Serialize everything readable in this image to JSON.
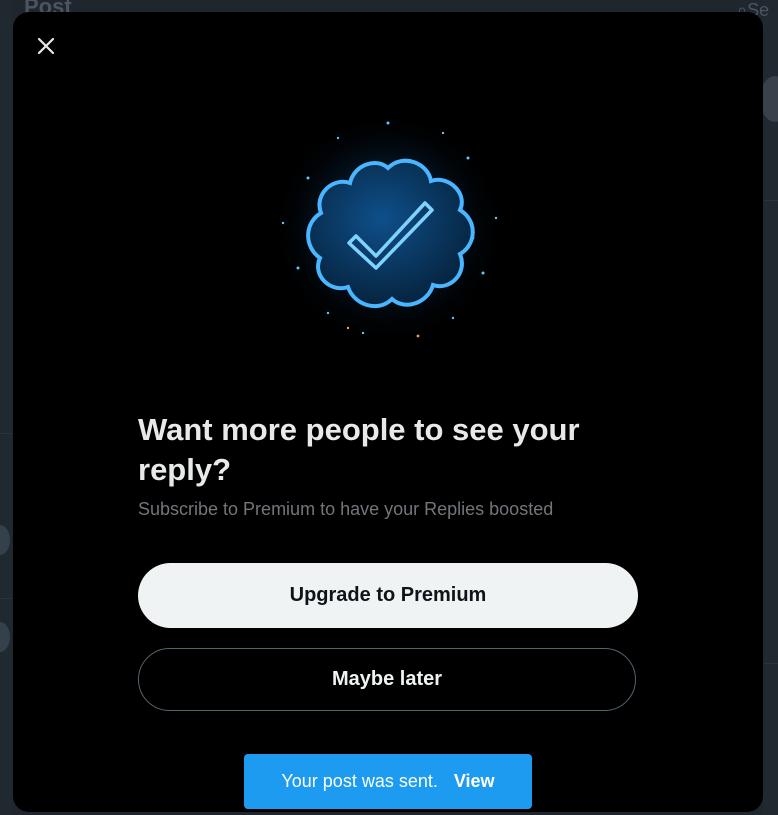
{
  "background": {
    "page_title": "Post",
    "search_hint": "Se"
  },
  "modal": {
    "close_icon": "close-icon",
    "badge_icon": "verified-badge-icon",
    "headline": "Want more people to see your reply?",
    "subtitle": "Subscribe to Premium to have your Replies boosted",
    "upgrade_label": "Upgrade to Premium",
    "later_label": "Maybe later"
  },
  "toast": {
    "message": "Your post was sent.",
    "action_label": "View"
  },
  "colors": {
    "modal_bg": "#000000",
    "primary_button_bg": "#eff3f4",
    "toast_bg": "#1d9bf0",
    "badge_blue": "#1d9bf0"
  }
}
